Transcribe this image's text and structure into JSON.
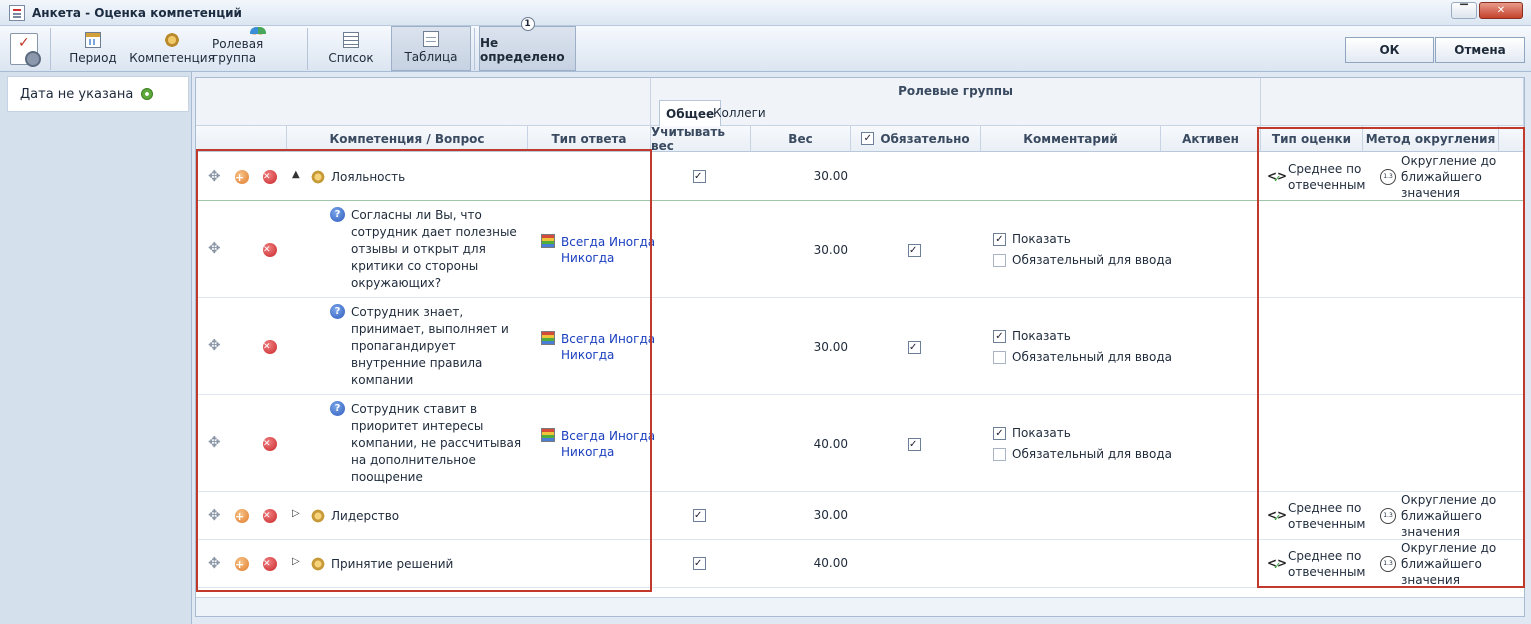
{
  "window": {
    "title": "Анкета - Оценка компетенций",
    "controls": [
      "▔",
      "✕"
    ]
  },
  "toolbar": {
    "period": "Период",
    "competence": "Компетенция",
    "role_group": "Ролевая группа",
    "list": "Список",
    "table": "Таблица",
    "undefined_badge": "1",
    "undefined": "Не определено",
    "ok": "ОК",
    "cancel": "Отмена"
  },
  "left_panel": {
    "date_label": "Дата не указана"
  },
  "grid": {
    "group_title": "Ролевые группы",
    "tabs": [
      "Общее",
      "Коллеги"
    ],
    "columns": {
      "competence": "Компетенция / Вопрос",
      "answer_type": "Тип ответа",
      "use_weight": "Учитывать вес",
      "weight": "Вес",
      "mandatory": "Обязательно",
      "comment": "Комментарий",
      "active": "Активен",
      "score_type": "Тип оценки",
      "rounding": "Метод округления"
    },
    "rows": [
      {
        "name": "Лояльность",
        "weight": "30.00",
        "score_type": [
          "Среднее по",
          "отвеченным"
        ],
        "rounding": [
          "Округление до",
          "ближайшего",
          "значения"
        ]
      },
      {
        "question": [
          "Согласны ли Вы, что",
          "сотрудник дает полезные",
          "отзывы и открыт для",
          "критики со стороны",
          "окружающих?"
        ],
        "answer": [
          "Всегда Иногда",
          "Никогда"
        ],
        "weight": "30.00",
        "show": "Показать",
        "required": "Обязательный для ввода"
      },
      {
        "question": [
          "Сотрудник знает,",
          "принимает, выполняет и",
          "пропагандирует",
          "внутренние правила",
          "компании"
        ],
        "answer": [
          "Всегда Иногда",
          "Никогда"
        ],
        "weight": "30.00",
        "show": "Показать",
        "required": "Обязательный для ввода"
      },
      {
        "question": [
          "Сотрудник ставит в",
          "приоритет интересы",
          "компании, не рассчитывая",
          "на дополнительное",
          "поощрение"
        ],
        "answer": [
          "Всегда Иногда",
          "Никогда"
        ],
        "weight": "40.00",
        "show": "Показать",
        "required": "Обязательный для ввода"
      },
      {
        "name": "Лидерство",
        "weight": "30.00",
        "score_type": [
          "Среднее по",
          "отвеченным"
        ],
        "rounding": [
          "Округление до",
          "ближайшего",
          "значения"
        ]
      },
      {
        "name": "Принятие решений",
        "weight": "40.00",
        "score_type": [
          "Среднее по",
          "отвеченным"
        ],
        "rounding": [
          "Округление до",
          "ближайшего",
          "значения"
        ]
      }
    ],
    "icons": {
      "expanded": "▲",
      "collapsed": "▷",
      "question": "?",
      "check": "✓",
      "add": "+",
      "delete": "✕",
      "rounding": "1.3"
    }
  }
}
